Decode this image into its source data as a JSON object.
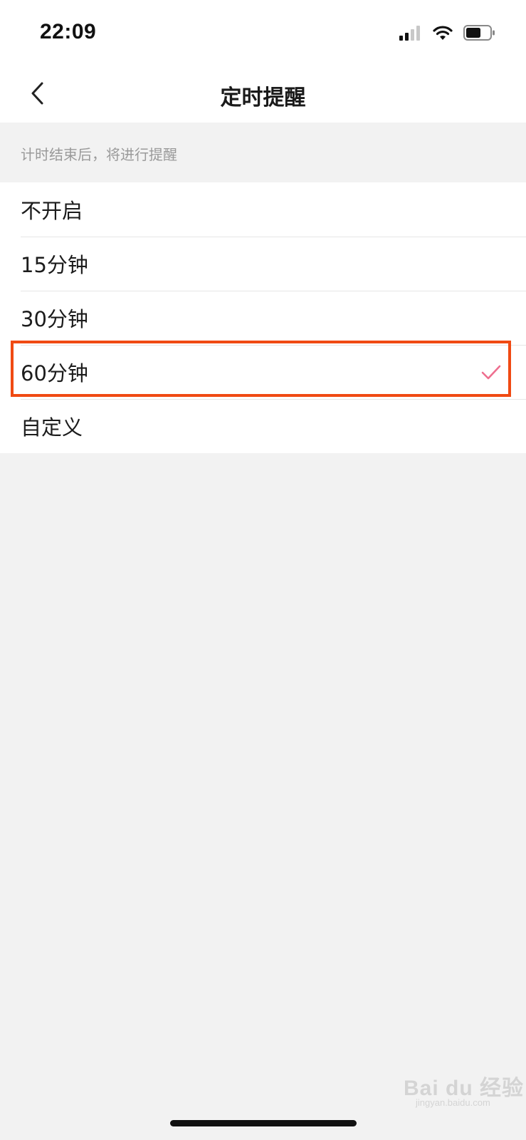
{
  "status_bar": {
    "time": "22:09",
    "icons": [
      "signal-icon",
      "wifi-icon",
      "battery-icon"
    ]
  },
  "nav": {
    "title": "定时提醒",
    "back_icon": "chevron-left-icon"
  },
  "hint": "计时结束后，将进行提醒",
  "options": [
    {
      "label": "不开启",
      "selected": false
    },
    {
      "label": "15分钟",
      "selected": false
    },
    {
      "label": "30分钟",
      "selected": false
    },
    {
      "label": "60分钟",
      "selected": true
    },
    {
      "label": "自定义",
      "selected": false
    }
  ],
  "colors": {
    "check": "#ee6f8f",
    "highlight_border": "#f04a13",
    "background": "#f2f2f2"
  },
  "watermark": {
    "brand": "Bai du 经验",
    "sub": "jingyan.baidu.com"
  }
}
